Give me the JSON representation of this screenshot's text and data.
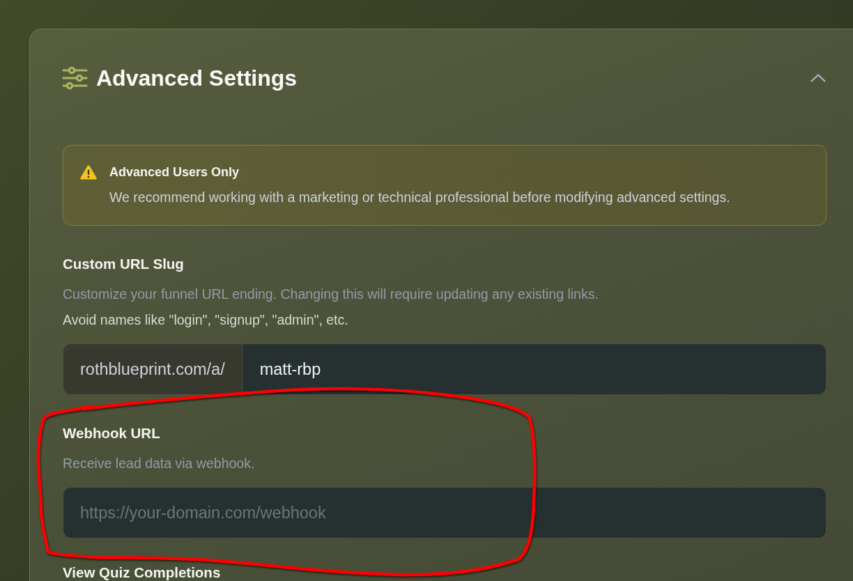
{
  "panel": {
    "title": "Advanced Settings",
    "expanded": true
  },
  "notice": {
    "title": "Advanced Users Only",
    "message": "We recommend working with a marketing or technical professional before modifying advanced settings."
  },
  "fields": [
    {
      "kind": "prefixed",
      "label": "Custom URL Slug",
      "help": "Customize your funnel URL ending. Changing this will require updating any existing links.",
      "note": "Avoid names like \"login\", \"signup\", \"admin\", etc.",
      "prefix": "rothblueprint.com/a/",
      "value": "matt-rbp"
    },
    {
      "kind": "text",
      "label": "Webhook URL",
      "help": "Receive lead data via webhook.",
      "placeholder": "https://your-domain.com/webhook"
    },
    {
      "kind": "heading",
      "label": "View Quiz Completions"
    }
  ]
}
